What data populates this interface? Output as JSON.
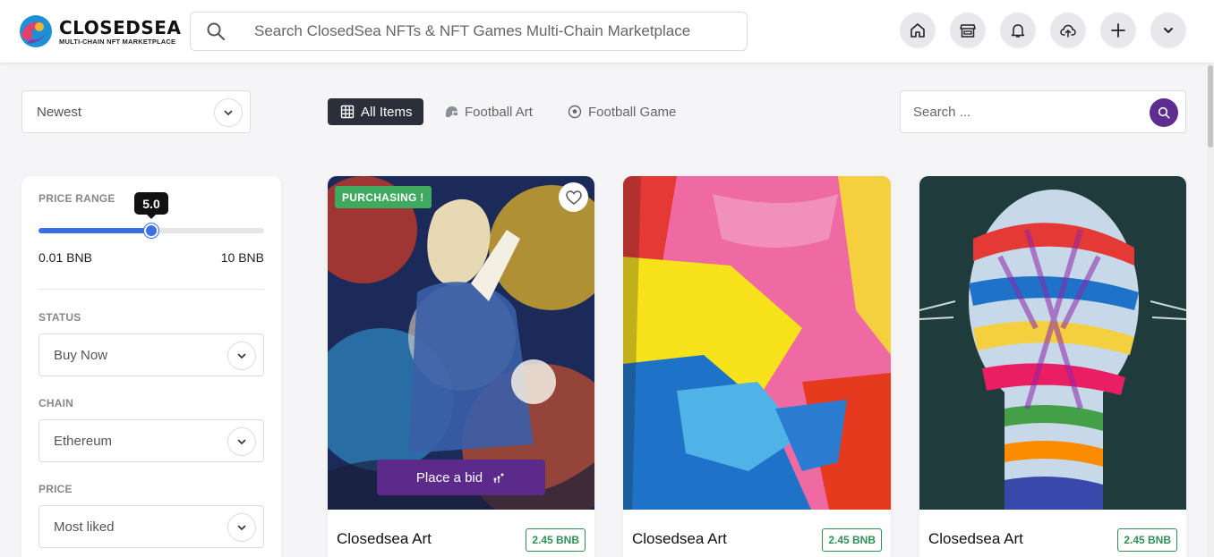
{
  "brand": {
    "name": "CLOSEDSEA",
    "tagline": "MULTI-CHAIN NFT MARKETPLACE"
  },
  "header": {
    "search_placeholder": "Search ClosedSea NFTs & NFT Games Multi-Chain Marketplace",
    "nav_icons": [
      "home-icon",
      "store-icon",
      "bell-icon",
      "upload-cloud-icon",
      "plus-icon",
      "chevron-down-icon"
    ]
  },
  "toolbar": {
    "sort_value": "Newest",
    "tabs": [
      {
        "label": "All Items",
        "icon": "grid-icon",
        "active": true
      },
      {
        "label": "Football Art",
        "icon": "helmet-icon",
        "active": false
      },
      {
        "label": "Football Game",
        "icon": "soccer-ball-icon",
        "active": false
      }
    ],
    "search_placeholder": "Search ..."
  },
  "filters": {
    "price_range_label": "PRICE RANGE",
    "price_value_display": "5.0",
    "price_fraction": 0.5,
    "range_min": "0.01 BNB",
    "range_max": "10 BNB",
    "status_label": "STATUS",
    "status_value": "Buy Now",
    "chain_label": "CHAIN",
    "chain_value": "Ethereum",
    "price_label": "PRICE",
    "price_value": "Most liked"
  },
  "cards": [
    {
      "title": "Closedsea Art",
      "price": "2.45 BNB",
      "badge": "PURCHASING !",
      "bid_label": "Place a bid"
    },
    {
      "title": "Closedsea Art",
      "price": "2.45 BNB"
    },
    {
      "title": "Closedsea Art",
      "price": "2.45 BNB"
    }
  ],
  "colors": {
    "accent_purple": "#5b2a8a",
    "slider_blue": "#3b6fe8",
    "badge_green": "#3faa5f",
    "price_green": "#2f8f57"
  }
}
